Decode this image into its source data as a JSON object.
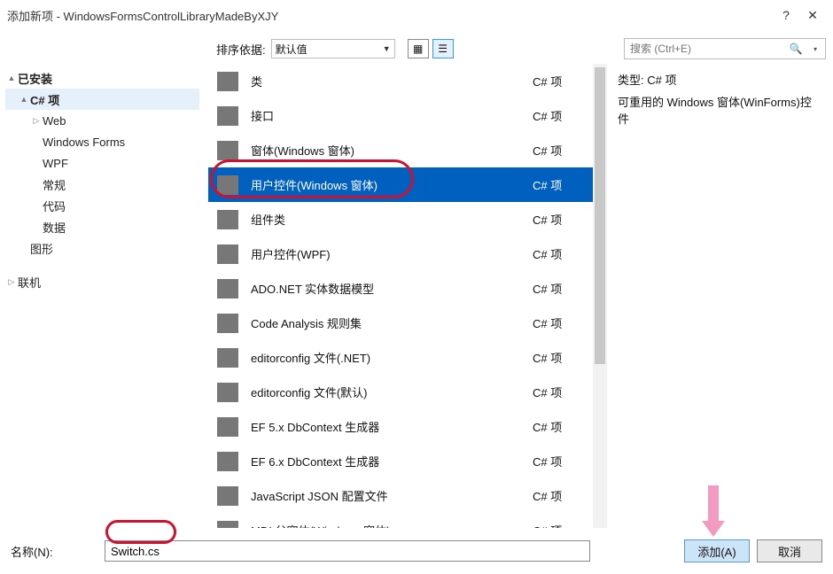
{
  "window": {
    "title": "添加新项 - WindowsFormsControlLibraryMadeByXJY",
    "help": "?",
    "close": "✕"
  },
  "toolbar": {
    "sort_label": "排序依据:",
    "sort_value": "默认值",
    "search_placeholder": "搜索 (Ctrl+E)"
  },
  "tree": {
    "installed": "已安装",
    "csharp_item": "C# 项",
    "web": "Web",
    "winforms": "Windows Forms",
    "wpf": "WPF",
    "general": "常规",
    "code": "代码",
    "data": "数据",
    "graphics": "图形",
    "online": "联机"
  },
  "items": [
    {
      "name": "类",
      "kind": "C# 项"
    },
    {
      "name": "接口",
      "kind": "C# 项"
    },
    {
      "name": "窗体(Windows 窗体)",
      "kind": "C# 项"
    },
    {
      "name": "用户控件(Windows 窗体)",
      "kind": "C# 项"
    },
    {
      "name": "组件类",
      "kind": "C# 项"
    },
    {
      "name": "用户控件(WPF)",
      "kind": "C# 项"
    },
    {
      "name": "ADO.NET 实体数据模型",
      "kind": "C# 项"
    },
    {
      "name": "Code Analysis 规则集",
      "kind": "C# 项"
    },
    {
      "name": "editorconfig 文件(.NET)",
      "kind": "C# 项"
    },
    {
      "name": "editorconfig 文件(默认)",
      "kind": "C# 项"
    },
    {
      "name": "EF 5.x DbContext 生成器",
      "kind": "C# 项"
    },
    {
      "name": "EF 6.x DbContext 生成器",
      "kind": "C# 项"
    },
    {
      "name": "JavaScript JSON 配置文件",
      "kind": "C# 项"
    },
    {
      "name": "MDI 父窗体(Windows 窗体)",
      "kind": "C# 项"
    }
  ],
  "details": {
    "type_label": "类型:",
    "type_value": "C# 项",
    "description": "可重用的 Windows 窗体(WinForms)控件"
  },
  "footer": {
    "name_label": "名称(N):",
    "name_value": "Switch.cs",
    "add": "添加(A)",
    "cancel": "取消"
  }
}
